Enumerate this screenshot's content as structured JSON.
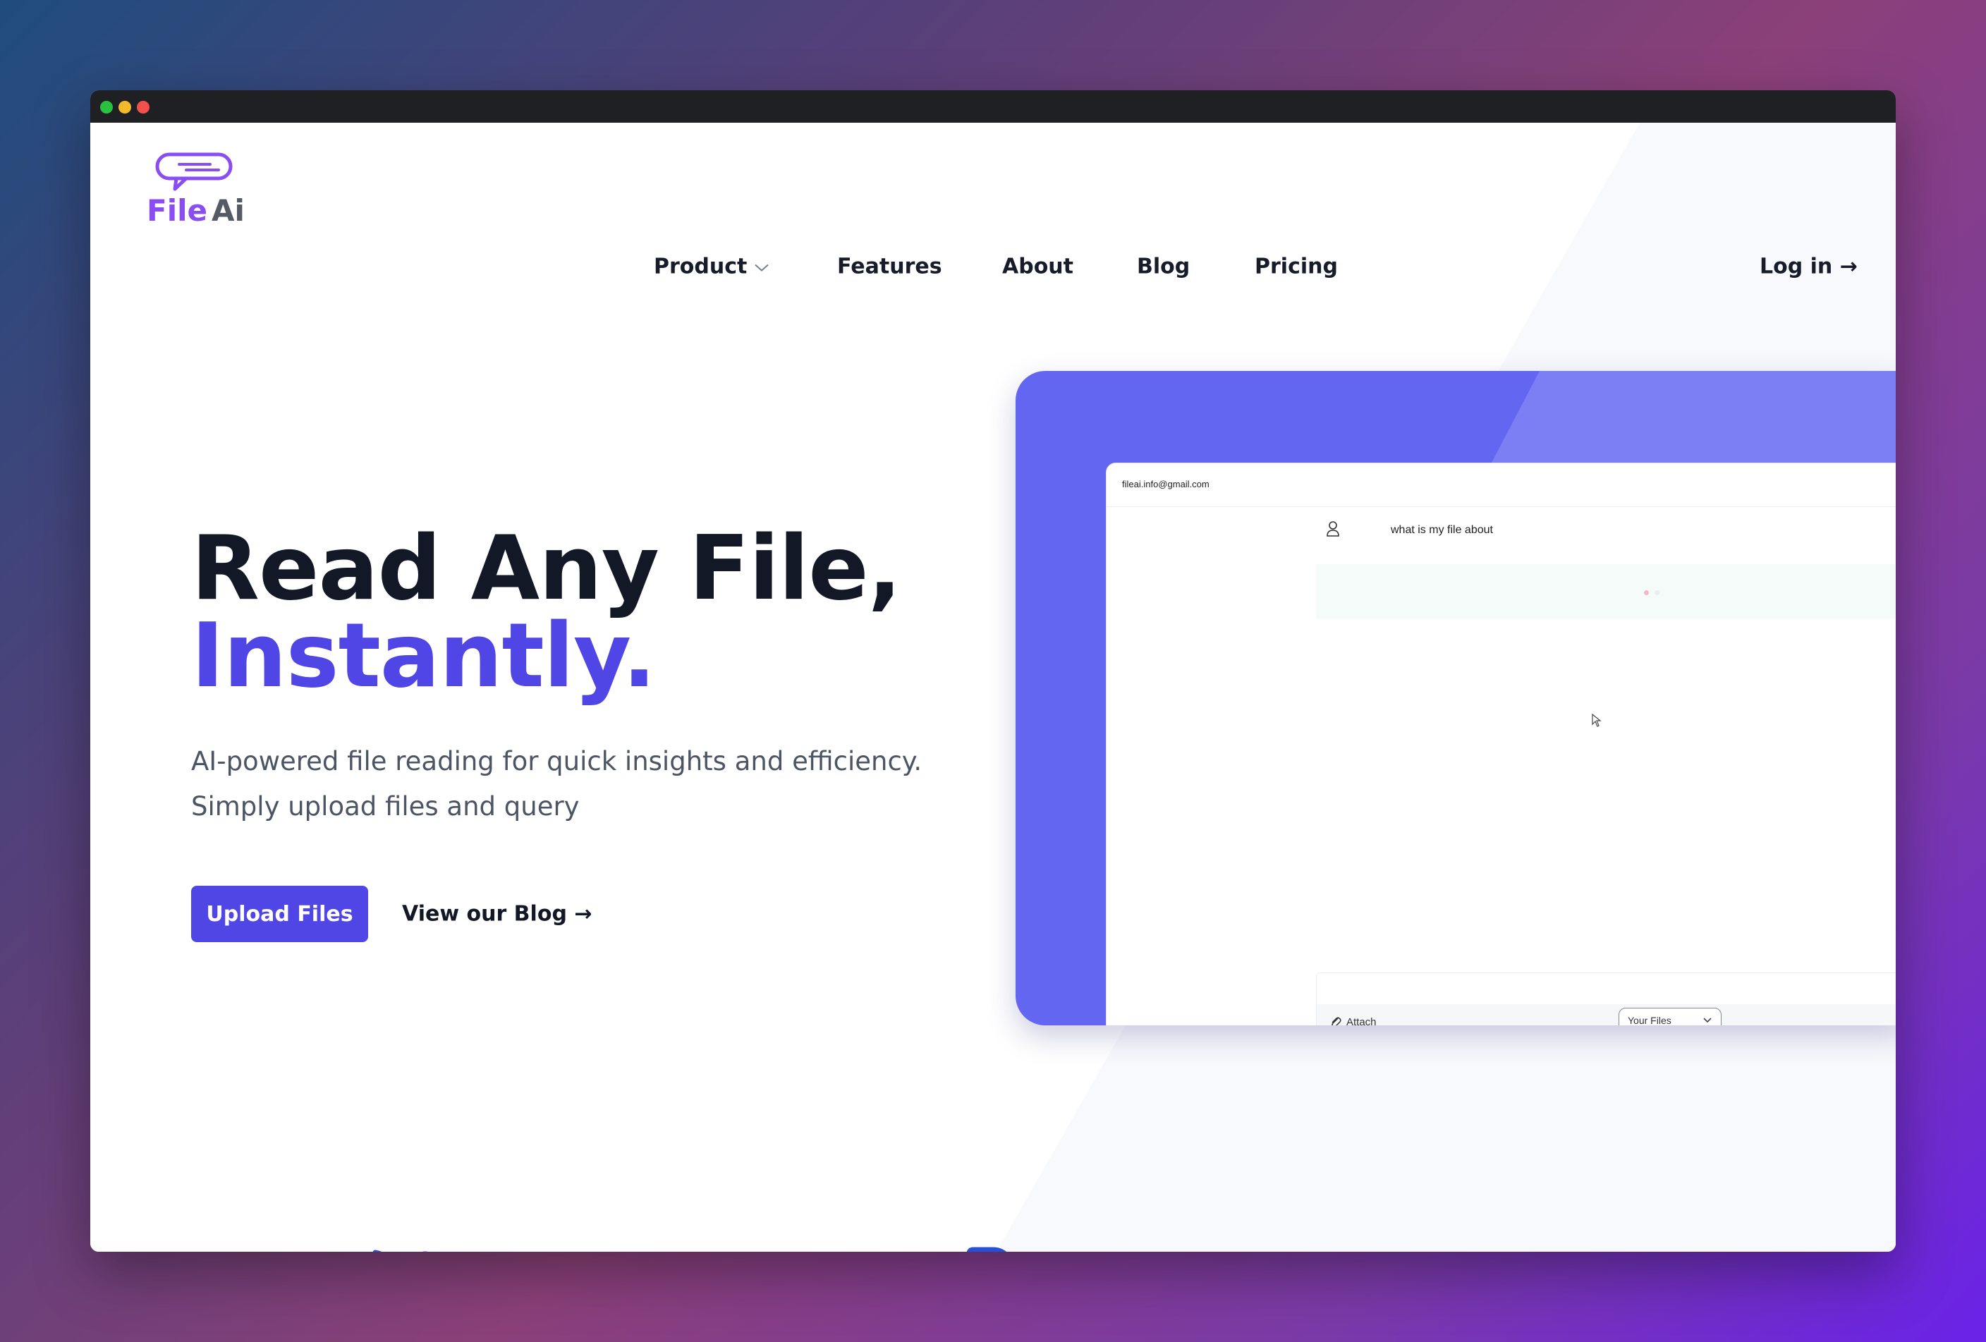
{
  "brand": {
    "part1": "File",
    "part2": "Ai"
  },
  "nav": {
    "items": [
      {
        "label": "Product",
        "has_dropdown": true
      },
      {
        "label": "Features"
      },
      {
        "label": "About"
      },
      {
        "label": "Blog"
      },
      {
        "label": "Pricing"
      }
    ],
    "login": "Log in →"
  },
  "hero": {
    "title_line1": "Read Any File,",
    "title_line2": "Instantly.",
    "subtitle_line1": "AI-powered file reading for quick insights and efficiency.",
    "subtitle_line2": "Simply upload files and query",
    "primary_button": "Upload Files",
    "secondary_link": "View our Blog →"
  },
  "preview": {
    "email": "fileai.info@gmail.com",
    "question": "what is my file about",
    "attach_label": "Attach",
    "select_value": "Your Files"
  },
  "colors": {
    "accent": "#4f46e5",
    "brand_purple": "#8a4df2",
    "preview_bg": "#6366f1",
    "text_dark": "#121826"
  },
  "icons": [
    "logo-chat-bubble-icon",
    "chevron-down-icon",
    "user-icon",
    "cursor-icon",
    "paperclip-icon",
    "chevron-down-icon",
    "tools-icon",
    "document-icon",
    "briefcase-icon"
  ]
}
